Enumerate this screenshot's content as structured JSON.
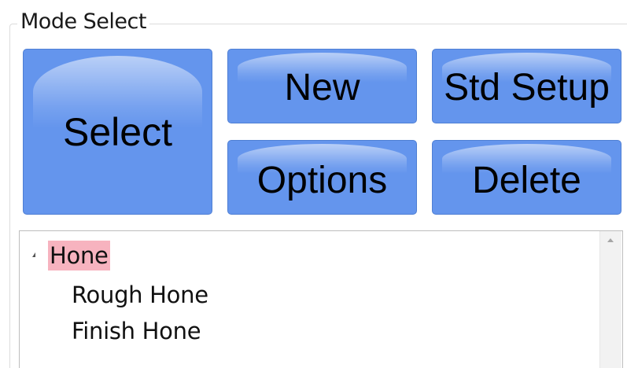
{
  "group": {
    "title": "Mode Select"
  },
  "buttons": {
    "select": "Select",
    "new": "New",
    "std_setup": "Std Setup",
    "options": "Options",
    "delete": "Delete"
  },
  "tree": {
    "root": {
      "label": "Hone",
      "expanded": true,
      "selected": true
    },
    "children": [
      {
        "label": "Rough Hone"
      },
      {
        "label": "Finish Hone"
      }
    ]
  },
  "colors": {
    "button_fill": "#6495ED",
    "selection_highlight": "#F7B3BF"
  },
  "icons": {
    "expander": "triangle-expanded-icon",
    "scroll_up": "scroll-up-arrow-icon"
  }
}
